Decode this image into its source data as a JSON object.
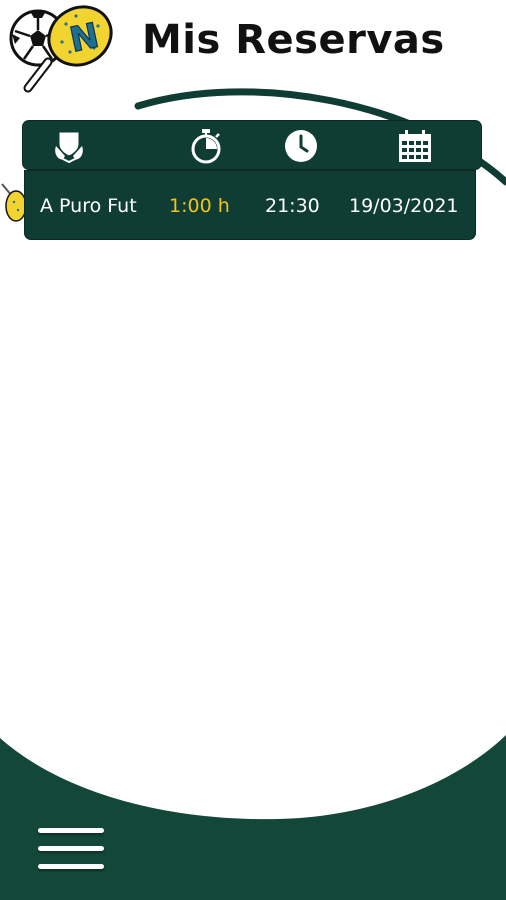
{
  "header": {
    "title": "Mis Reservas",
    "logo_icon": "soccer-ball-padel-racket-logo",
    "logo_letter": "N"
  },
  "table_header": {
    "columns": [
      {
        "key": "venue",
        "icon": "trophy-shield-icon"
      },
      {
        "key": "duration",
        "icon": "stopwatch-icon"
      },
      {
        "key": "time",
        "icon": "clock-icon"
      },
      {
        "key": "date",
        "icon": "calendar-icon"
      }
    ]
  },
  "reservations": [
    {
      "venue": "A Puro Fut",
      "duration": "1:00 h",
      "time": "21:30",
      "date": "19/03/2021"
    }
  ],
  "nav": {
    "menu_icon": "hamburger-menu-icon"
  },
  "colors": {
    "primary_green": "#0f3d33",
    "accent_yellow": "#f2c21a",
    "text_white": "#ffffff",
    "title_black": "#111111"
  }
}
